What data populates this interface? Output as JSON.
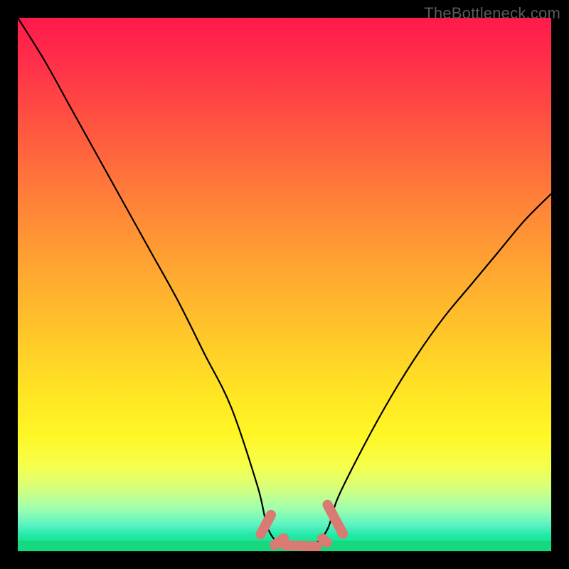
{
  "watermark": {
    "text": "TheBottleneck.com"
  },
  "chart_data": {
    "type": "line",
    "title": "",
    "xlabel": "",
    "ylabel": "",
    "xlim": [
      0,
      100
    ],
    "ylim": [
      0,
      100
    ],
    "grid": false,
    "legend": false,
    "series": [
      {
        "name": "bottleneck-curve",
        "color": "#000000",
        "x": [
          0,
          5,
          10,
          15,
          20,
          25,
          30,
          35,
          40,
          45,
          47,
          50,
          55,
          58,
          60,
          65,
          70,
          75,
          80,
          85,
          90,
          95,
          100
        ],
        "y": [
          100,
          92,
          83,
          74,
          65,
          56,
          47,
          37,
          27,
          12,
          4,
          1,
          1,
          4,
          10,
          20,
          29,
          37,
          44,
          50,
          56,
          62,
          67
        ]
      }
    ],
    "markers": [
      {
        "name": "valley-markers",
        "color": "#d97b72",
        "style": "rounded-bar",
        "points": [
          {
            "x": 46.5,
            "y": 5.0,
            "len": 6,
            "angle": -62
          },
          {
            "x": 49.0,
            "y": 1.8,
            "len": 4,
            "angle": -35
          },
          {
            "x": 53.0,
            "y": 1.0,
            "len": 8,
            "angle": 3
          },
          {
            "x": 57.5,
            "y": 2.0,
            "len": 3,
            "angle": 40
          },
          {
            "x": 59.5,
            "y": 6.0,
            "len": 8,
            "angle": 62
          }
        ]
      }
    ],
    "gradient_stops": [
      {
        "pct": 0,
        "color": "#ff1a4b"
      },
      {
        "pct": 50,
        "color": "#ffb92e"
      },
      {
        "pct": 82,
        "color": "#fff84a"
      },
      {
        "pct": 100,
        "color": "#16d87f"
      }
    ]
  }
}
